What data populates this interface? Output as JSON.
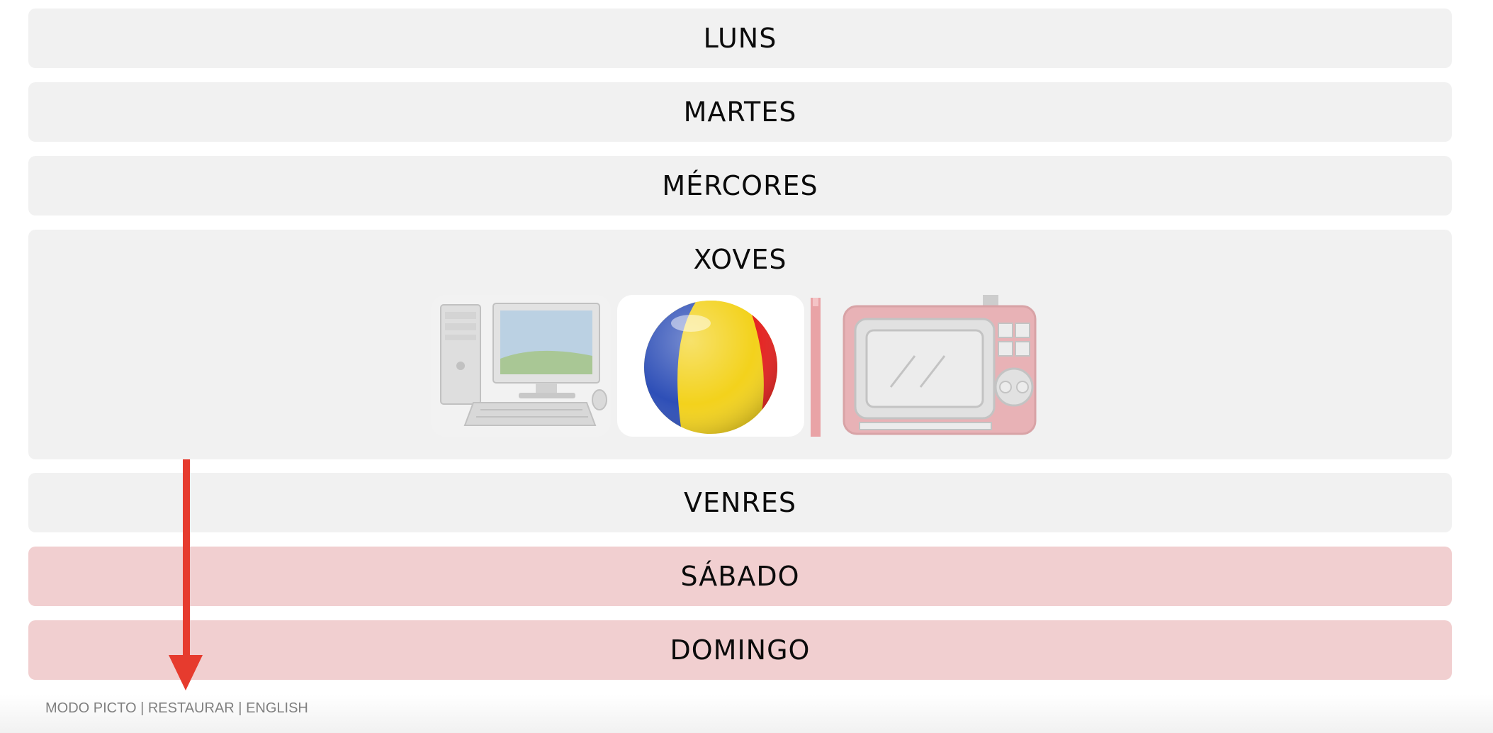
{
  "days": {
    "monday": "LUNS",
    "tuesday": "MARTES",
    "wednesday": "MÉRCORES",
    "thursday": "XOVES",
    "friday": "VENRES",
    "saturday": "SÁBADO",
    "sunday": "DOMINGO"
  },
  "thursday_pictograms": {
    "items": [
      {
        "icon": "computer-icon",
        "state": "faded"
      },
      {
        "icon": "beach-ball-icon",
        "state": "active"
      },
      {
        "icon": "tv-icon",
        "state": "faded"
      }
    ]
  },
  "footer": {
    "picto_mode": "MODO PICTO",
    "separator": "|",
    "restore": "RESTAURAR",
    "english": "ENGLISH"
  },
  "colors": {
    "weekday_bg": "#f1f1f1",
    "weekend_bg": "#f1cfd0",
    "annotation_arrow": "#e63b2e"
  }
}
